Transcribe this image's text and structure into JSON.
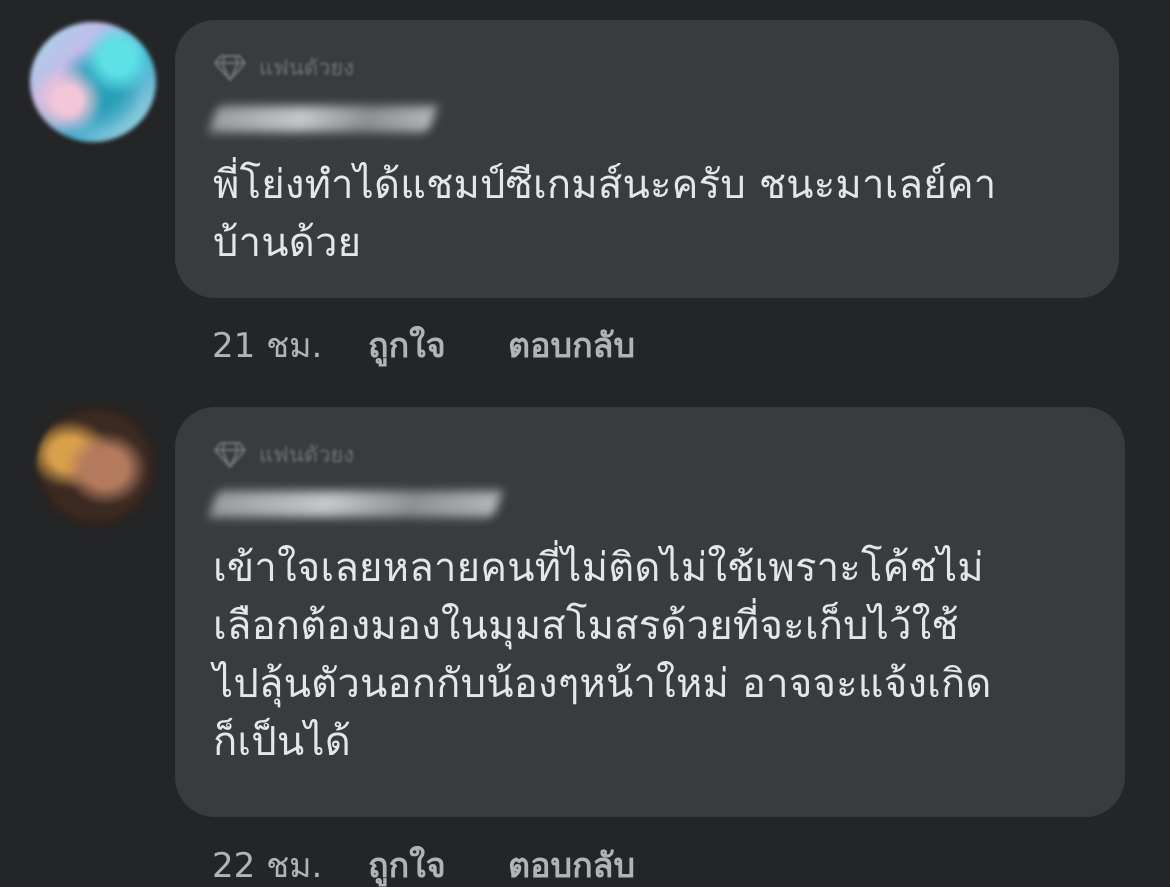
{
  "comments": [
    {
      "badge": "แฟนตัวยง",
      "text": "พี่โย่งทำได้แชมป์ซีเกมส์นะครับ ชนะมาเลย์คา\nบ้านด้วย",
      "time": "21 ชม.",
      "like_label": "ถูกใจ",
      "reply_label": "ตอบกลับ"
    },
    {
      "badge": "แฟนตัวยง",
      "text": "เข้าใจเลยหลายคนที่ไม่ติดไม่ใช้เพราะโค้ชไม่\nเลือกต้องมองในมุมสโมสรด้วยที่จะเก็บไว้ใช้\nไปลุ้นตัวนอกกับน้องๆหน้าใหม่ อาจจะแจ้งเกิด\nก็เป็นได้",
      "time": "22 ชม.",
      "like_label": "ถูกใจ",
      "reply_label": "ตอบกลับ"
    }
  ],
  "icons": {
    "badge": "diamond-icon"
  },
  "colors": {
    "background": "#242526",
    "bubble": "#3a3b3c",
    "text": "#e4e6eb",
    "meta": "#b0b3b8"
  }
}
